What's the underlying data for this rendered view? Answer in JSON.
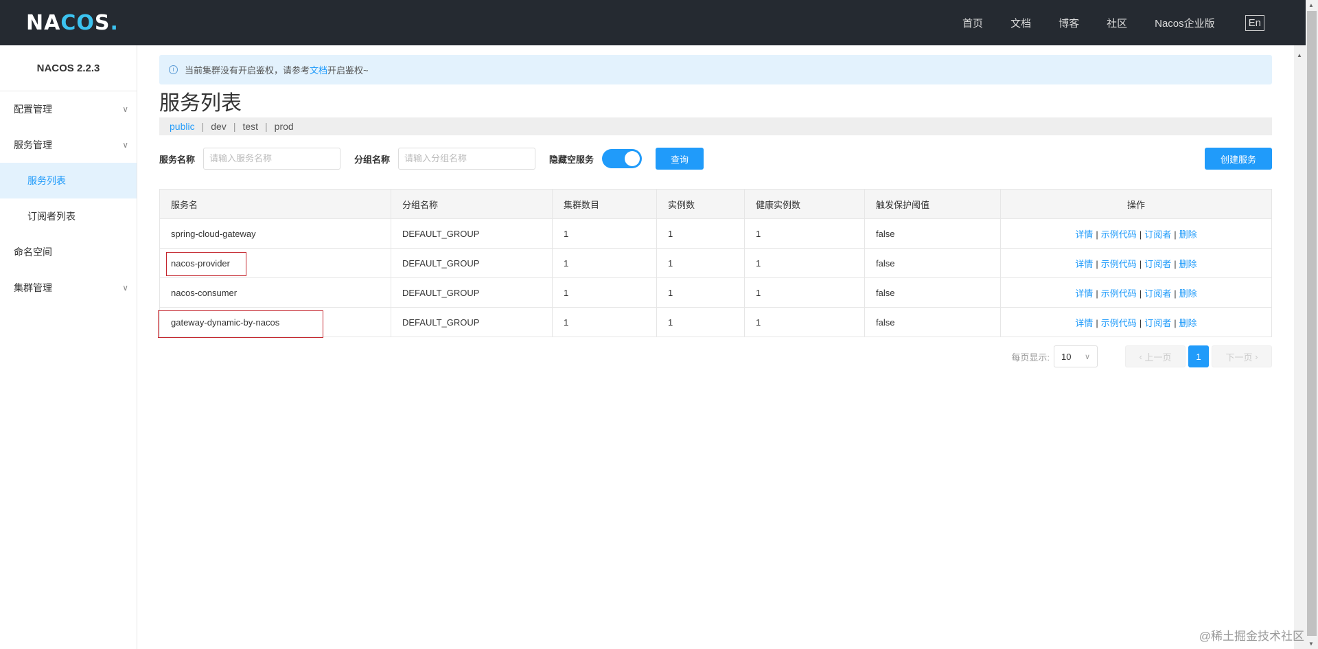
{
  "header": {
    "logo": "NACOS.",
    "nav": [
      "首页",
      "文档",
      "博客",
      "社区",
      "Nacos企业版"
    ],
    "lang": "En"
  },
  "sidebar": {
    "version": "NACOS 2.2.3",
    "items": [
      {
        "label": "配置管理",
        "chevron": true
      },
      {
        "label": "服务管理",
        "chevron": true
      },
      {
        "label": "服务列表",
        "sub": true,
        "active": true
      },
      {
        "label": "订阅者列表",
        "sub": true
      },
      {
        "label": "命名空间"
      },
      {
        "label": "集群管理",
        "chevron": true
      }
    ]
  },
  "alert": {
    "before": "当前集群没有开启鉴权，请参考",
    "link": "文档",
    "after": "开启鉴权~"
  },
  "page": {
    "title": "服务列表"
  },
  "namespaces": [
    "public",
    "dev",
    "test",
    "prod"
  ],
  "filters": {
    "service_label": "服务名称",
    "service_placeholder": "请输入服务名称",
    "group_label": "分组名称",
    "group_placeholder": "请输入分组名称",
    "hide_empty_label": "隐藏空服务",
    "hide_empty_on": true,
    "query": "查询",
    "create": "创建服务"
  },
  "table": {
    "columns": [
      "服务名",
      "分组名称",
      "集群数目",
      "实例数",
      "健康实例数",
      "触发保护阈值",
      "操作"
    ],
    "rows": [
      [
        "spring-cloud-gateway",
        "DEFAULT_GROUP",
        "1",
        "1",
        "1",
        "false"
      ],
      [
        "nacos-provider",
        "DEFAULT_GROUP",
        "1",
        "1",
        "1",
        "false"
      ],
      [
        "nacos-consumer",
        "DEFAULT_GROUP",
        "1",
        "1",
        "1",
        "false"
      ],
      [
        "gateway-dynamic-by-nacos",
        "DEFAULT_GROUP",
        "1",
        "1",
        "1",
        "false"
      ]
    ],
    "actions": [
      "详情",
      "示例代码",
      "订阅者",
      "删除"
    ]
  },
  "pagination": {
    "page_size_label": "每页显示:",
    "page_size": "10",
    "prev": "上一页",
    "current": "1",
    "next": "下一页"
  },
  "watermark": "@稀土掘金技术社区",
  "colors": {
    "accent": "#209bfa",
    "topbar": "#252a31",
    "highlight": "#c4262e"
  }
}
